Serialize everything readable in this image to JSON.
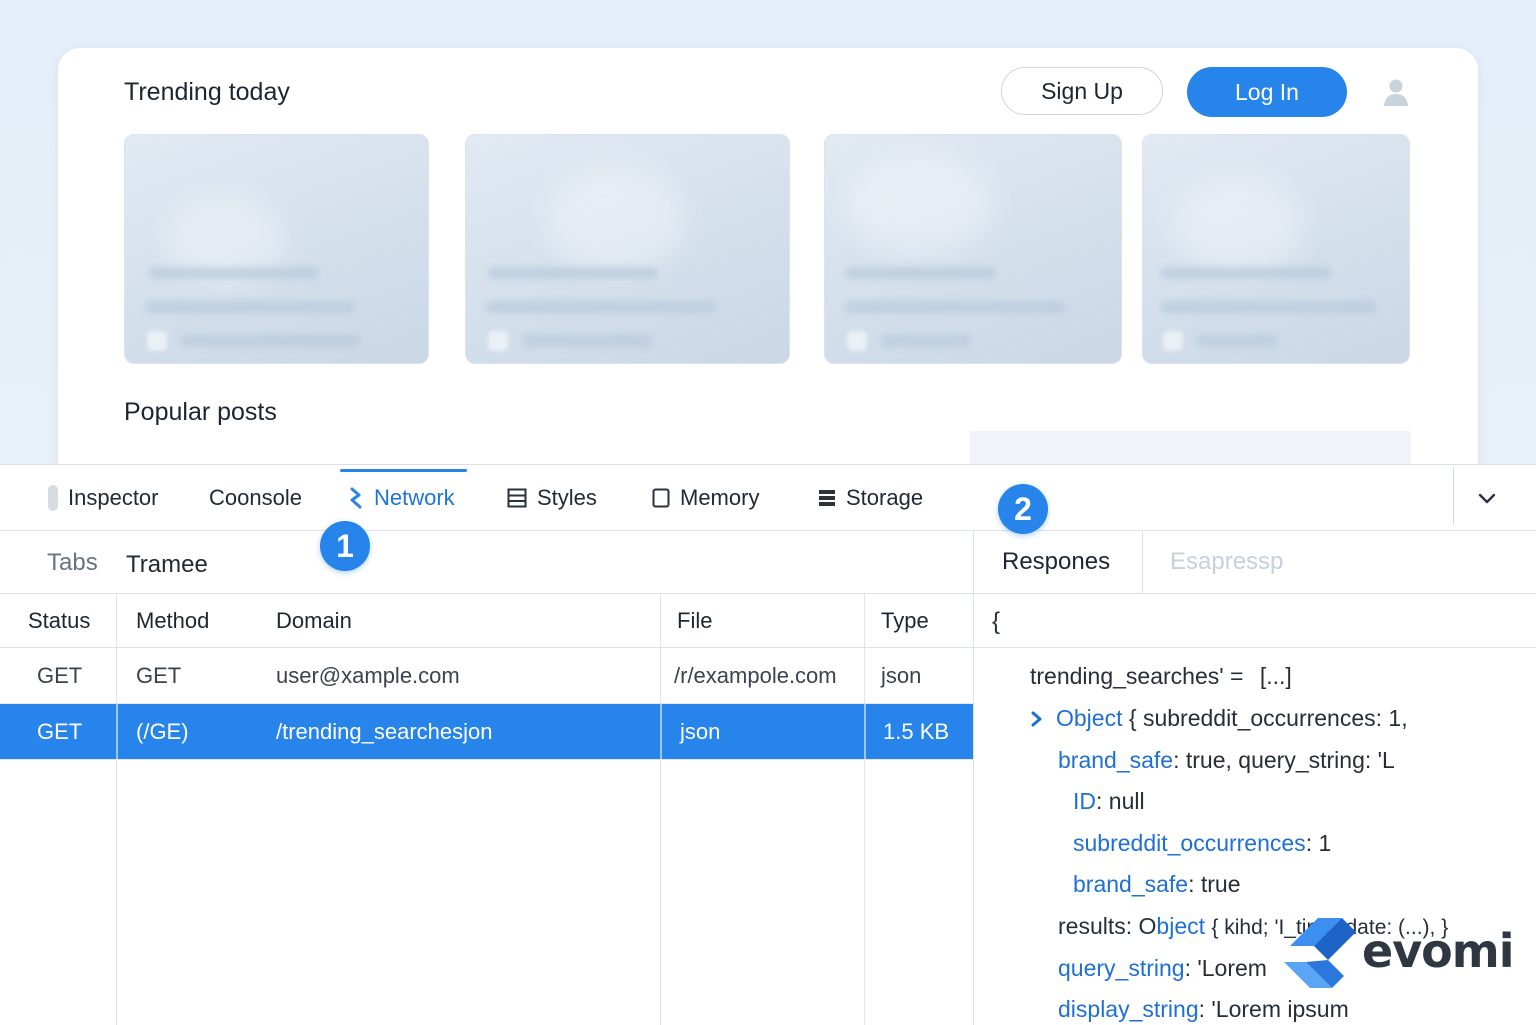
{
  "page": {
    "trending_title": "Trending today",
    "signup_label": "Sign Up",
    "login_label": "Log In",
    "popular_title": "Popular posts"
  },
  "devtools": {
    "tabs": [
      {
        "label": "Inspector",
        "icon": "inspector-icon"
      },
      {
        "label": "Coonsole",
        "icon": ""
      },
      {
        "label": "Network",
        "icon": "network-icon",
        "active": true
      },
      {
        "label": "Styles",
        "icon": "styles-icon"
      },
      {
        "label": "Memory",
        "icon": "memory-icon"
      },
      {
        "label": "Storage",
        "icon": "storage-icon"
      }
    ],
    "badges": [
      "1",
      "2"
    ],
    "subbar": {
      "tabs_label": "Tabs",
      "frame_label": "Tramee"
    },
    "columns": [
      "Status",
      "Method",
      "Domain",
      "File",
      "Type"
    ],
    "rows": [
      {
        "status": "GET",
        "method": "GET",
        "domain": "user@xample.com",
        "file": "/r/exampole.com",
        "type": "json",
        "selected": false
      },
      {
        "status": "GET",
        "method": "(/GE)",
        "domain": "/trending_searchesjon",
        "file": "json",
        "type": "1.5 KB",
        "selected": true
      }
    ],
    "response_tabs": {
      "active": "Respones",
      "inactive": "Esapressp"
    },
    "json": {
      "open_brace": "{",
      "l1_key": "trending_searches' =",
      "l1_val": "[...]",
      "l2_key": "Object",
      "l2_val": "{ subreddit_occurrences: 1,",
      "l3_key": "brand_safe",
      "l3_val": ": true, query_string: 'L",
      "l4_key": "ID",
      "l4_val": ": null",
      "l5_key": "subreddit_occurrences",
      "l5_val": ": 1",
      "l6_key": "brand_safe",
      "l6_val": ": true",
      "l7_pre": "results: O",
      "l7_key": "bject",
      "l7_val": "{ kihd; 'I_ting', date: (...), }",
      "l8_key": "query_string",
      "l8_val": ": 'Lorem",
      "l9_key": "display_string",
      "l9_val": ": 'Lorem ipsum"
    }
  },
  "watermark": {
    "text": "evomi"
  },
  "colors": {
    "accent": "#2684ea",
    "key": "#1e6fd6",
    "selected_row": "#2684ea"
  }
}
